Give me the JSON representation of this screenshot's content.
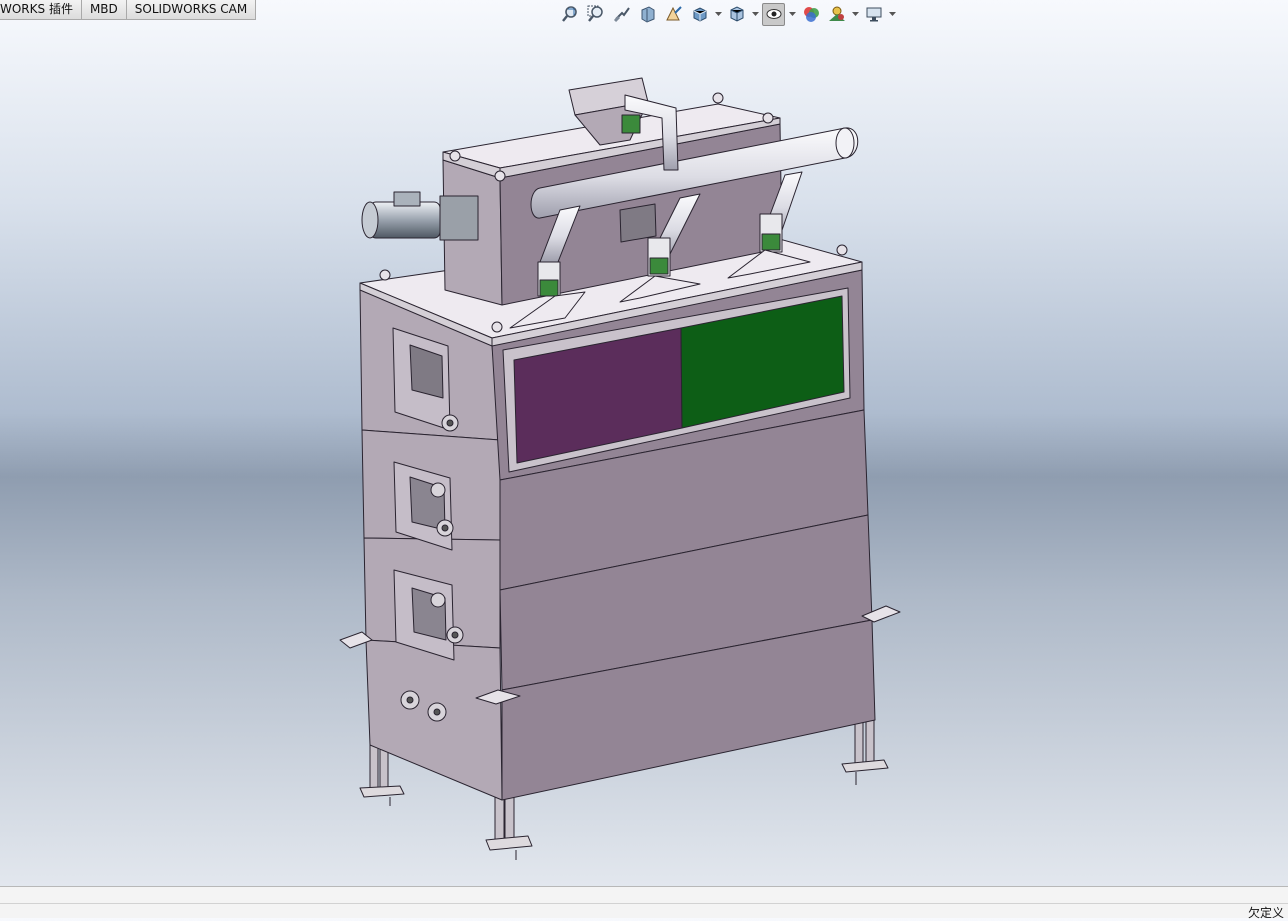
{
  "tabs": [
    {
      "label": "WORKS 插件"
    },
    {
      "label": "MBD"
    },
    {
      "label": "SOLIDWORKS CAM"
    }
  ],
  "heads_up_toolbar": {
    "icons": [
      "zoom-to-fit-icon",
      "zoom-to-area-icon",
      "previous-view-icon",
      "section-view-icon",
      "dynamic-annotation-view-icon",
      "view-orientation-icon",
      "display-style-icon",
      "hide-show-items-icon",
      "edit-appearance-icon",
      "apply-scene-icon",
      "view-settings-icon"
    ]
  },
  "model": {
    "panel_colors": {
      "left": "#5b2d5b",
      "right": "#0d5e16"
    },
    "body_color": "#938595"
  },
  "status": {
    "text": "欠定义"
  }
}
